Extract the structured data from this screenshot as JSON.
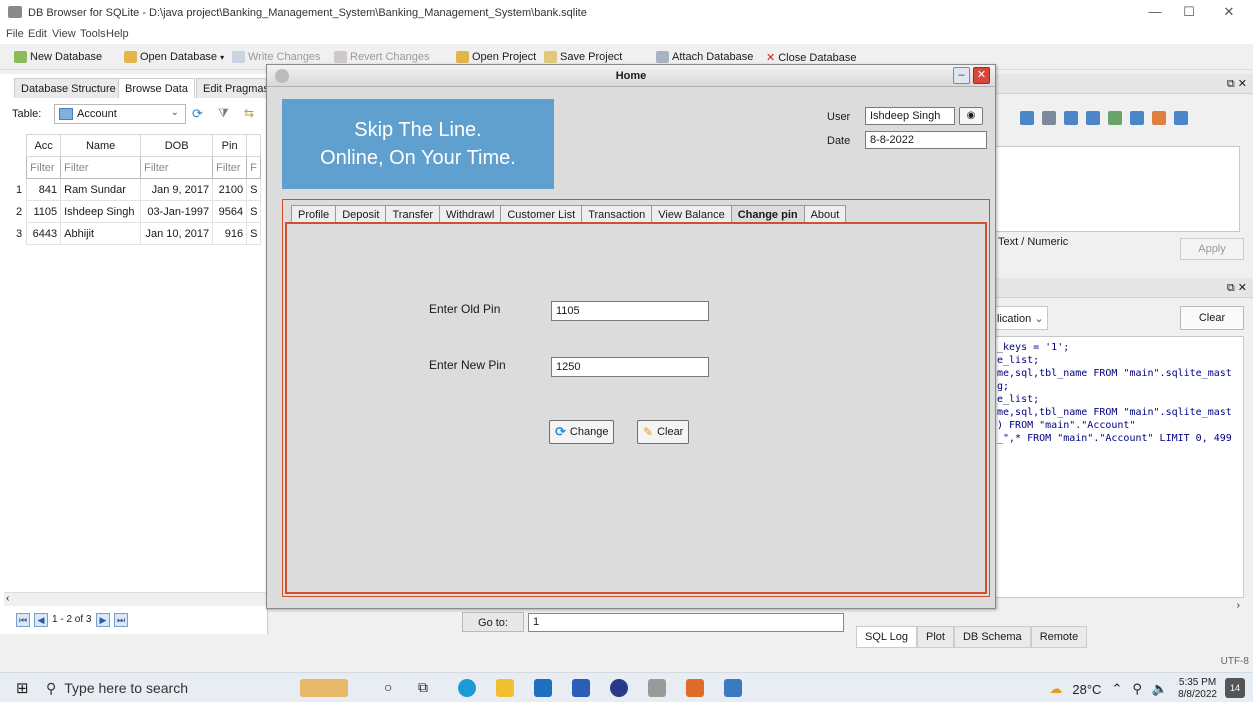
{
  "window": {
    "title": "DB Browser for SQLite - D:\\java project\\Banking_Management_System\\Banking_Management_System\\bank.sqlite",
    "minimize": "—",
    "maximize": "☐",
    "close": "✕"
  },
  "menu": [
    "File",
    "Edit",
    "View",
    "Tools",
    "Help"
  ],
  "toolbar": {
    "new_db": "New Database",
    "open_db": "Open Database",
    "write": "Write Changes",
    "revert": "Revert Changes",
    "open_project": "Open Project",
    "save_project": "Save Project",
    "attach": "Attach Database",
    "close_db": "Close Database"
  },
  "left": {
    "tabs": [
      "Database Structure",
      "Browse Data",
      "Edit Pragmas"
    ],
    "table_label": "Table:",
    "table_value": "Account",
    "columns": [
      "Acc",
      "Name",
      "DOB",
      "Pin"
    ],
    "filter_short": "Filter",
    "filter_name": "Filter",
    "rows": [
      {
        "n": "1",
        "acc": "841",
        "name": "Ram Sundar",
        "dob": "Jan 9, 2017",
        "pin": "2100",
        "extra": "S"
      },
      {
        "n": "2",
        "acc": "1105",
        "name": "Ishdeep Singh",
        "dob": "03-Jan-1997",
        "pin": "9564",
        "extra": "S"
      },
      {
        "n": "3",
        "acc": "6443",
        "name": "Abhijit",
        "dob": "Jan 10, 2017",
        "pin": "916",
        "extra": "S"
      }
    ],
    "record_count": "1 - 2 of 3",
    "goto_label": "Go to:",
    "goto_value": "1"
  },
  "right": {
    "type_label": "Text / Numeric",
    "apply": "Apply",
    "mode": "lication",
    "clear": "Clear",
    "sql_lines": [
      "_keys = '1';",
      "e_list;",
      "me,sql,tbl_name FROM \"main\".sqlite_mast",
      "g;",
      "e_list;",
      "me,sql,tbl_name FROM \"main\".sqlite_mast",
      ") FROM \"main\".\"Account\"",
      "_\",* FROM \"main\".\"Account\" LIMIT 0, 499"
    ],
    "bottom_tabs": [
      "SQL Log",
      "Plot",
      "DB Schema",
      "Remote"
    ],
    "encoding": "UTF-8"
  },
  "dialog": {
    "title": "Home",
    "banner_line1": "Skip The Line.",
    "banner_line2": "Online, On Your Time.",
    "user_label": "User",
    "user_value": "Ishdeep Singh",
    "date_label": "Date",
    "date_value": "8-8-2022",
    "tabs": [
      "Profile",
      "Deposit",
      "Transfer",
      "Withdrawl",
      "Customer List",
      "Transaction",
      "View Balance",
      "Change pin",
      "About"
    ],
    "active_tab": "Change pin",
    "old_pin_label": "Enter Old Pin",
    "old_pin_value": "1105",
    "new_pin_label": "Enter New Pin",
    "new_pin_value": "1250",
    "change_btn": "Change",
    "clear_btn": "Clear"
  },
  "taskbar": {
    "search_placeholder": "Type here to search",
    "temperature": "28°C",
    "time": "5:35 PM",
    "date": "8/8/2022",
    "notifications": "14"
  },
  "colors": {
    "banner": "#5fa0cf",
    "tab_border": "#d05030"
  }
}
